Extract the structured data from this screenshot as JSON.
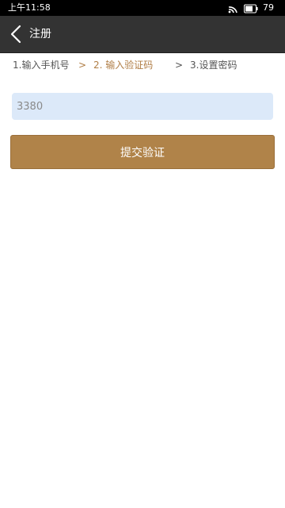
{
  "status_bar": {
    "time": "上午11:58",
    "battery_level": "79",
    "icons": [
      "wifi-icon",
      "battery-icon"
    ]
  },
  "header": {
    "title": "注册",
    "back_icon": "chevron-left-icon"
  },
  "steps": {
    "items": [
      {
        "label": "1.输入手机号",
        "active": false
      },
      {
        "label": "2. 输入验证码",
        "active": true
      },
      {
        "label": "3.设置密码",
        "active": false
      }
    ],
    "separator": ">"
  },
  "form": {
    "code_value": "3380"
  },
  "actions": {
    "submit_label": "提交验证"
  },
  "colors": {
    "accent": "#b08349",
    "active_step": "#b07d45",
    "header_bg": "#333333",
    "input_bg": "#dce9f9"
  }
}
